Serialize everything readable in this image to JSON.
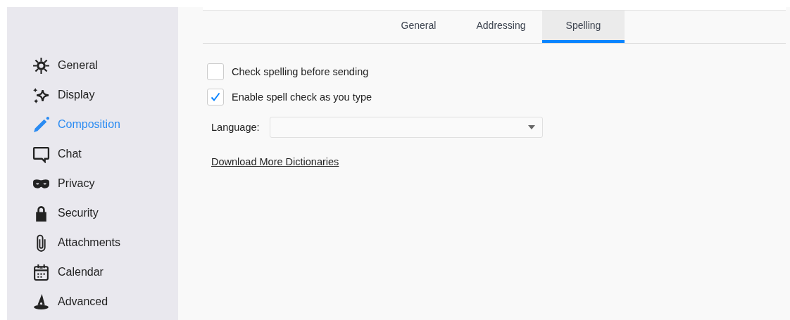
{
  "sidebar": {
    "items": [
      {
        "label": "General",
        "kind": "gear",
        "selected": false
      },
      {
        "label": "Display",
        "kind": "sparkle",
        "selected": false
      },
      {
        "label": "Composition",
        "kind": "pencil",
        "selected": true
      },
      {
        "label": "Chat",
        "kind": "chat",
        "selected": false
      },
      {
        "label": "Privacy",
        "kind": "mask",
        "selected": false
      },
      {
        "label": "Security",
        "kind": "lock",
        "selected": false
      },
      {
        "label": "Attachments",
        "kind": "clip",
        "selected": false
      },
      {
        "label": "Calendar",
        "kind": "calendar",
        "selected": false
      },
      {
        "label": "Advanced",
        "kind": "hat",
        "selected": false
      }
    ]
  },
  "tabs": [
    {
      "label": "General",
      "selected": false
    },
    {
      "label": "Addressing",
      "selected": false
    },
    {
      "label": "Spelling",
      "selected": true
    }
  ],
  "options": [
    {
      "label": "Check spelling before sending",
      "checked": false
    },
    {
      "label": "Enable spell check as you type",
      "checked": true
    }
  ],
  "language": {
    "label": "Language:"
  },
  "link": "Download More Dictionaries"
}
